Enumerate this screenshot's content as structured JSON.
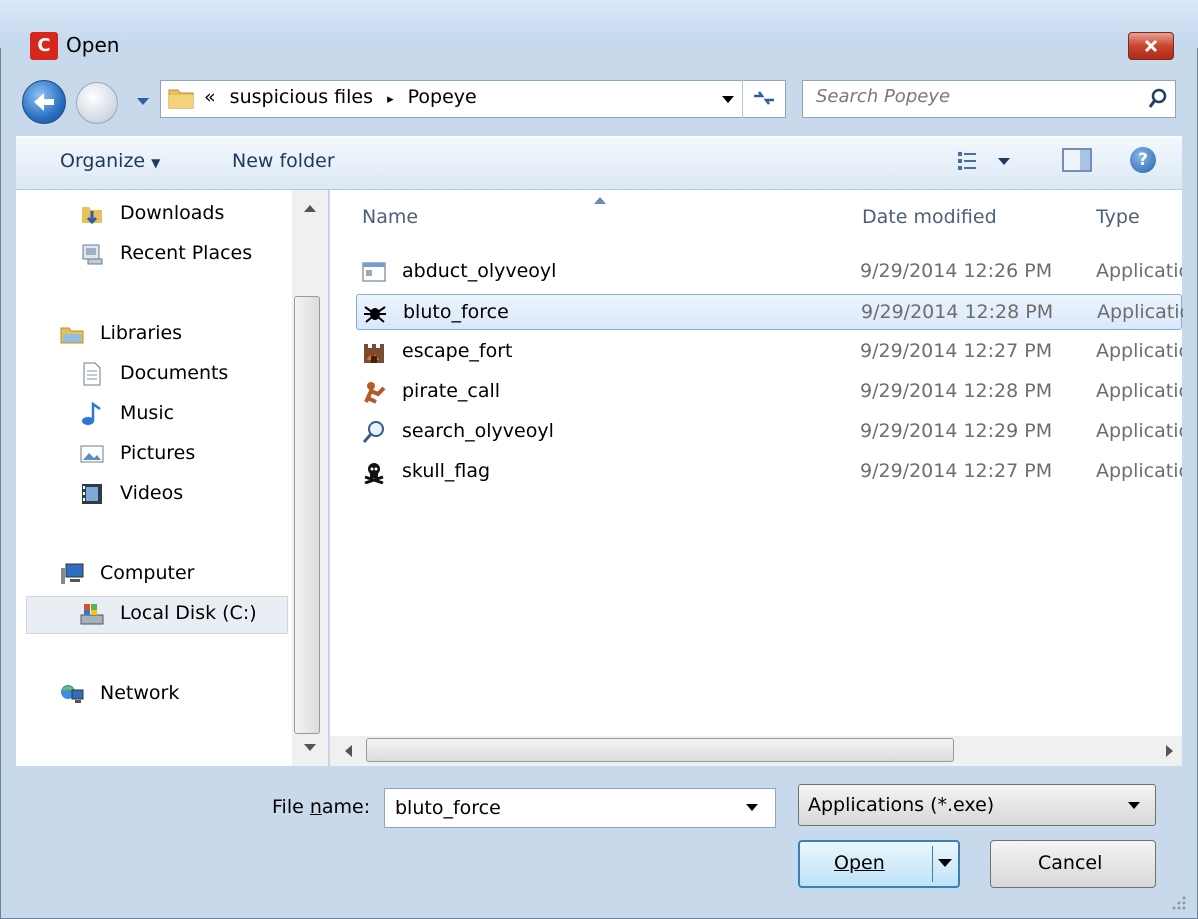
{
  "window": {
    "title": "Open",
    "app_icon_letter": "C",
    "close_symbol": "x"
  },
  "navigation": {
    "breadcrumb": [
      "«",
      "suspicious files",
      "▸",
      "Popeye"
    ],
    "search_placeholder": "Search Popeye"
  },
  "toolbar": {
    "organize_label": "Organize",
    "new_folder_label": "New folder"
  },
  "nav_pane": {
    "items": [
      {
        "label": "Downloads",
        "icon": "downloads-folder-icon"
      },
      {
        "label": "Recent Places",
        "icon": "recent-places-icon"
      },
      {
        "label": "Libraries",
        "icon": "libraries-icon"
      },
      {
        "label": "Documents",
        "icon": "documents-icon"
      },
      {
        "label": "Music",
        "icon": "music-icon"
      },
      {
        "label": "Pictures",
        "icon": "pictures-icon"
      },
      {
        "label": "Videos",
        "icon": "videos-icon"
      },
      {
        "label": "Computer",
        "icon": "computer-icon"
      },
      {
        "label": "Local Disk (C:)",
        "icon": "local-disk-icon"
      },
      {
        "label": "Network",
        "icon": "network-icon"
      }
    ]
  },
  "file_list": {
    "columns": [
      "Name",
      "Date modified",
      "Type"
    ],
    "rows": [
      {
        "name": "abduct_olyveoyl",
        "date": "9/29/2014 12:26 PM",
        "type": "Applicatio",
        "icon": "application-window-icon"
      },
      {
        "name": "bluto_force",
        "date": "9/29/2014 12:28 PM",
        "type": "Applicatio",
        "icon": "spider-icon",
        "selected": true
      },
      {
        "name": "escape_fort",
        "date": "9/29/2014 12:27 PM",
        "type": "Applicatio",
        "icon": "fire-castle-icon"
      },
      {
        "name": "pirate_call",
        "date": "9/29/2014 12:28 PM",
        "type": "Applicatio",
        "icon": "pirate-icon"
      },
      {
        "name": "search_olyveoyl",
        "date": "9/29/2014 12:29 PM",
        "type": "Applicatio",
        "icon": "magnifier-icon"
      },
      {
        "name": "skull_flag",
        "date": "9/29/2014 12:27 PM",
        "type": "Applicatio",
        "icon": "skull-icon"
      }
    ]
  },
  "bottom": {
    "filename_label_mnemonic": "n",
    "filename_label_prefix": "File ",
    "filename_label_suffix": "ame:",
    "filename_value": "bluto_force",
    "filetype_value": "Applications (*.exe)",
    "open_label": "Open",
    "cancel_label": "Cancel"
  },
  "colors": {
    "selection": "#d8e8fb",
    "accent": "#3c7fb1",
    "close_red": "#c8452f"
  }
}
